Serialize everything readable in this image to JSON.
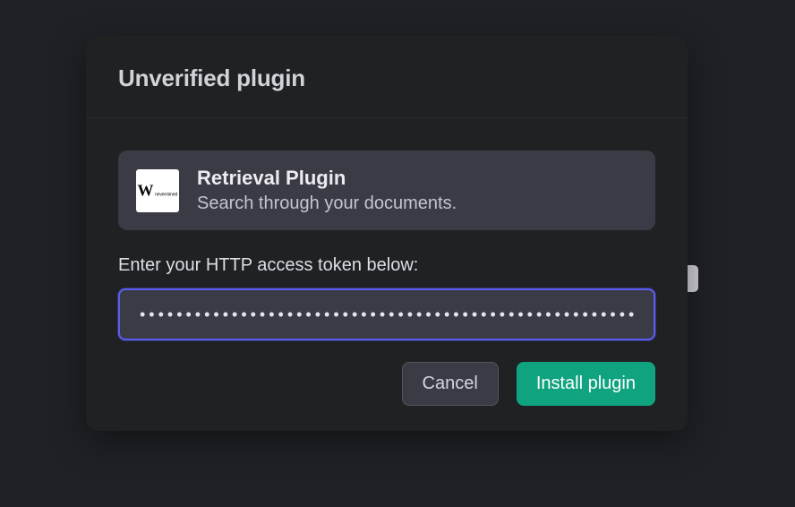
{
  "modal": {
    "title": "Unverified plugin",
    "plugin": {
      "logo_glyph": "W",
      "logo_text": "nevermined",
      "name": "Retrieval Plugin",
      "description": "Search through your documents."
    },
    "token_label": "Enter your HTTP access token below:",
    "token_value": "••••••••••••••••••••••••••••••••••••••••••••••••••••••••••••••••••••••••••••••",
    "actions": {
      "cancel": "Cancel",
      "install": "Install plugin"
    }
  }
}
